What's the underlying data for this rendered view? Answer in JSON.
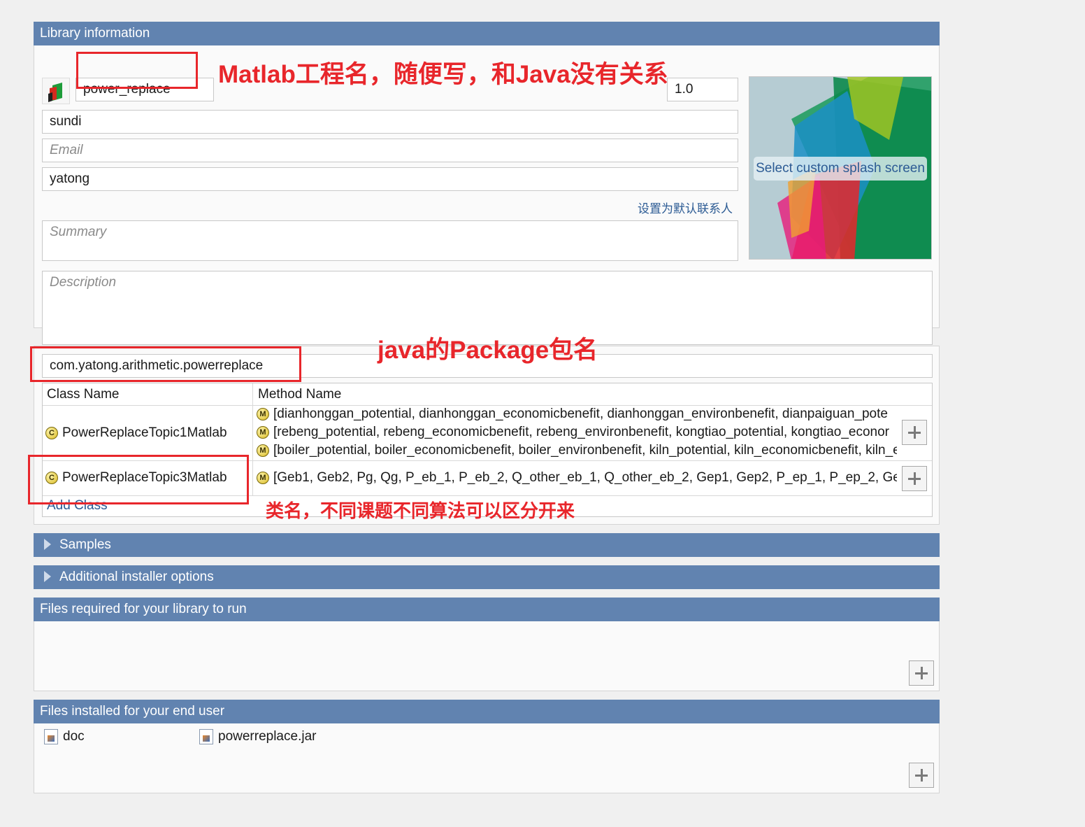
{
  "library_info": {
    "header": "Library information",
    "library_name": "power_replace",
    "version_partial": "1.0",
    "author": "sundi",
    "email_placeholder": "Email",
    "company": "yatong",
    "set_default_contact": "设置为默认联系人",
    "summary_placeholder": "Summary",
    "description_placeholder": "Description",
    "splash_button": "Select custom splash screen"
  },
  "package": {
    "name": "com.yatong.arithmetic.powerreplace"
  },
  "class_table": {
    "col_class": "Class Name",
    "col_method": "Method Name",
    "rows": [
      {
        "class_name": "PowerReplaceTopic1Matlab",
        "methods": [
          "[dianhonggan_potential, dianhonggan_economicbenefit, dianhonggan_environbenefit, dianpaiguan_pote",
          "[rebeng_potential, rebeng_economicbenefit, rebeng_environbenefit, kongtiao_potential, kongtiao_econor",
          "[boiler_potential, boiler_economicbenefit, boiler_environbenefit, kiln_potential, kiln_economicbenefit, kiln_e"
        ]
      },
      {
        "class_name": "PowerReplaceTopic3Matlab",
        "methods": [
          "[Geb1, Geb2, Pg, Qg, P_eb_1, P_eb_2, Q_other_eb_1, Q_other_eb_2, Gep1, Gep2, P_ep_1, P_ep_2, Ge1, P_e"
        ]
      }
    ],
    "add_class": "Add Class"
  },
  "sections": {
    "samples": "Samples",
    "installer_options": "Additional installer options",
    "files_required": "Files required for your library to run",
    "files_installed": "Files installed for your end user"
  },
  "installed_files": [
    "doc",
    "powerreplace.jar"
  ],
  "annotations": {
    "matlab_project": "Matlab工程名，随便写，和Java没有关系",
    "java_package": "java的Package包名",
    "class_name_note": "类名，不同课题不同算法可以区分开来"
  },
  "colors": {
    "header_bg": "#6183b0",
    "annotation_red": "#e8262b",
    "link_blue": "#2c5b94"
  }
}
